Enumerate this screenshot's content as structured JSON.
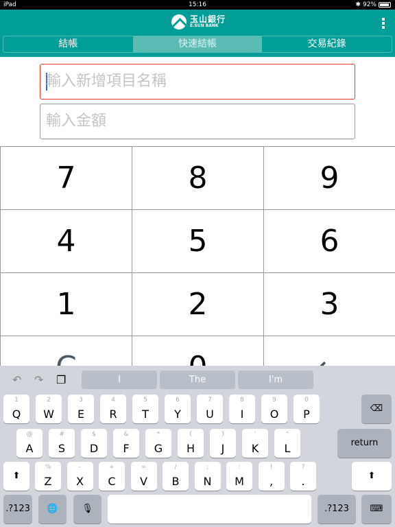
{
  "status": {
    "device": "iPad",
    "time": "15:16",
    "battery": "92%",
    "battery_level": 0.92
  },
  "header": {
    "logo_zh": "玉山銀行",
    "logo_en": "E.SUN BANK",
    "tabs": [
      {
        "label": "結帳"
      },
      {
        "label": "快速結帳",
        "active": true
      },
      {
        "label": "交易紀錄"
      }
    ],
    "color": "#009e96"
  },
  "form": {
    "item_placeholder": "輸入新增項目名稱",
    "amount_placeholder": "輸入金額"
  },
  "numpad": [
    "7",
    "8",
    "9",
    "4",
    "5",
    "6",
    "1",
    "2",
    "3",
    "C",
    "0",
    "←"
  ],
  "keyboard": {
    "suggestions": [
      "I",
      "The",
      "I'm"
    ],
    "row1": [
      [
        "1",
        "Q"
      ],
      [
        "2",
        "W"
      ],
      [
        "3",
        "E"
      ],
      [
        "4",
        "R"
      ],
      [
        "5",
        "T"
      ],
      [
        "6",
        "Y"
      ],
      [
        "7",
        "U"
      ],
      [
        "8",
        "I"
      ],
      [
        "9",
        "O"
      ],
      [
        "0",
        "P"
      ]
    ],
    "row2": [
      [
        "@",
        "A"
      ],
      [
        "#",
        "S"
      ],
      [
        "$",
        "D"
      ],
      [
        "&",
        "F"
      ],
      [
        "*",
        "G"
      ],
      [
        "(",
        "H"
      ],
      [
        ")",
        "J"
      ],
      [
        "'",
        "K"
      ],
      [
        "\"",
        "L"
      ]
    ],
    "row3": [
      [
        "%",
        "Z"
      ],
      [
        "-",
        "X"
      ],
      [
        "+",
        "C"
      ],
      [
        "=",
        "V"
      ],
      [
        "/",
        "B"
      ],
      [
        ";",
        "N"
      ],
      [
        ":",
        "M"
      ],
      [
        "!",
        ","
      ],
      [
        "?",
        "."
      ]
    ],
    "return": "return",
    "numbers": ".?123",
    "backspace": "⌫",
    "shift": "⬆",
    "globe": "🌐",
    "mic": "🎙",
    "hide": "⌨"
  }
}
